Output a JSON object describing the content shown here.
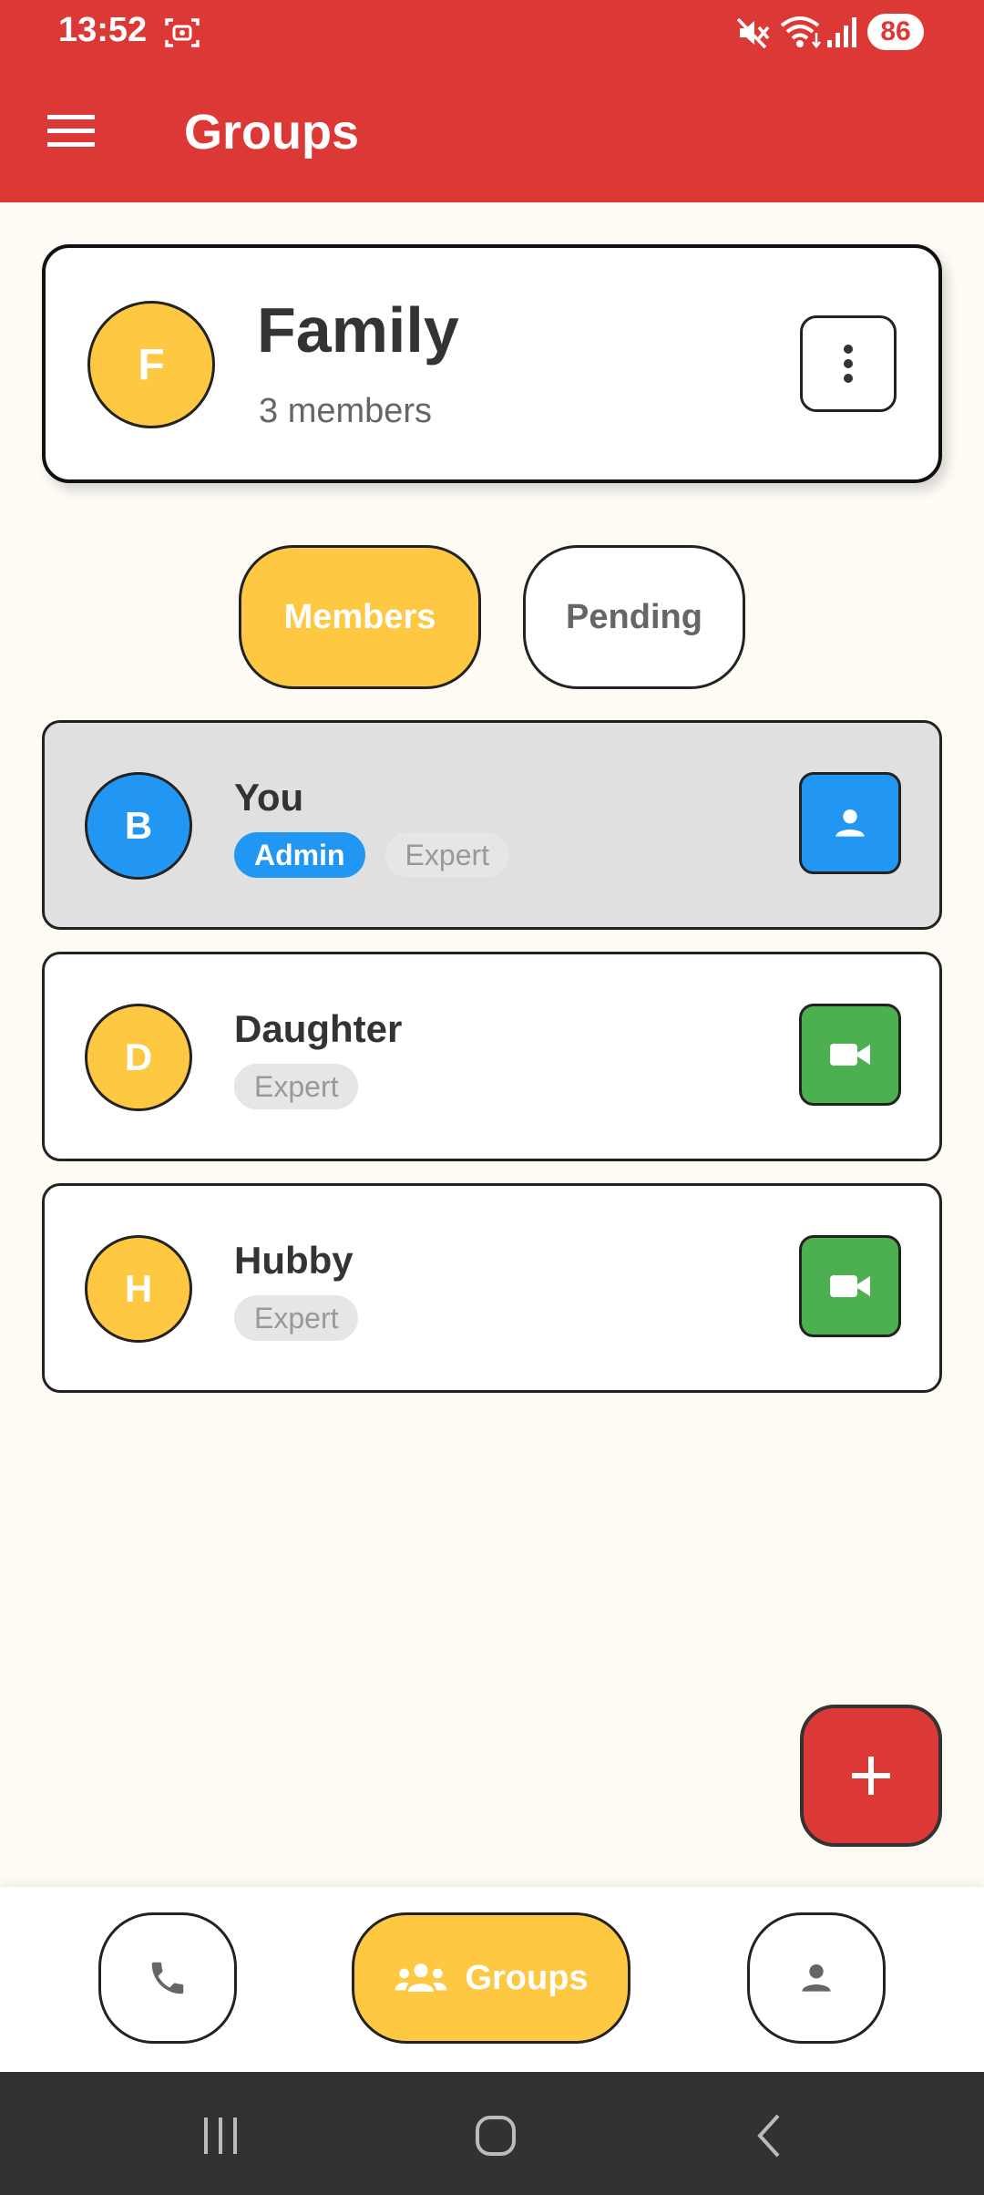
{
  "status_bar": {
    "time": "13:52",
    "battery": "86",
    "icons": [
      "screenshot-icon",
      "mute-icon",
      "wifi-icon",
      "signal-icon"
    ]
  },
  "app_bar": {
    "title": "Groups",
    "menu_icon": "hamburger-menu-icon"
  },
  "group": {
    "initial": "F",
    "name": "Family",
    "members_count": "3 members",
    "options_icon": "more-vertical-icon"
  },
  "tabs": [
    {
      "label": "Members",
      "active": true
    },
    {
      "label": "Pending",
      "active": false
    }
  ],
  "members": [
    {
      "initial": "B",
      "name": "You",
      "tags": [
        "Admin",
        "Expert"
      ],
      "action_icon": "person-icon",
      "avatar_color": "#2196f3",
      "action_color": "#2196f3"
    },
    {
      "initial": "D",
      "name": "Daughter",
      "tags": [
        "Expert"
      ],
      "action_icon": "video-camera-icon",
      "avatar_color": "#fec842",
      "action_color": "#4caf50"
    },
    {
      "initial": "H",
      "name": "Hubby",
      "tags": [
        "Expert"
      ],
      "action_icon": "video-camera-icon",
      "avatar_color": "#fec842",
      "action_color": "#4caf50"
    }
  ],
  "fab": {
    "icon": "plus-icon"
  },
  "bottom_nav": {
    "calls_icon": "phone-icon",
    "groups_label": "Groups",
    "groups_icon": "groups-icon",
    "profile_icon": "person-icon"
  },
  "colors": {
    "primary_red": "#dc3835",
    "accent_yellow": "#fec842",
    "admin_blue": "#2196f3",
    "video_green": "#4caf50",
    "background": "#fdfbf4"
  }
}
